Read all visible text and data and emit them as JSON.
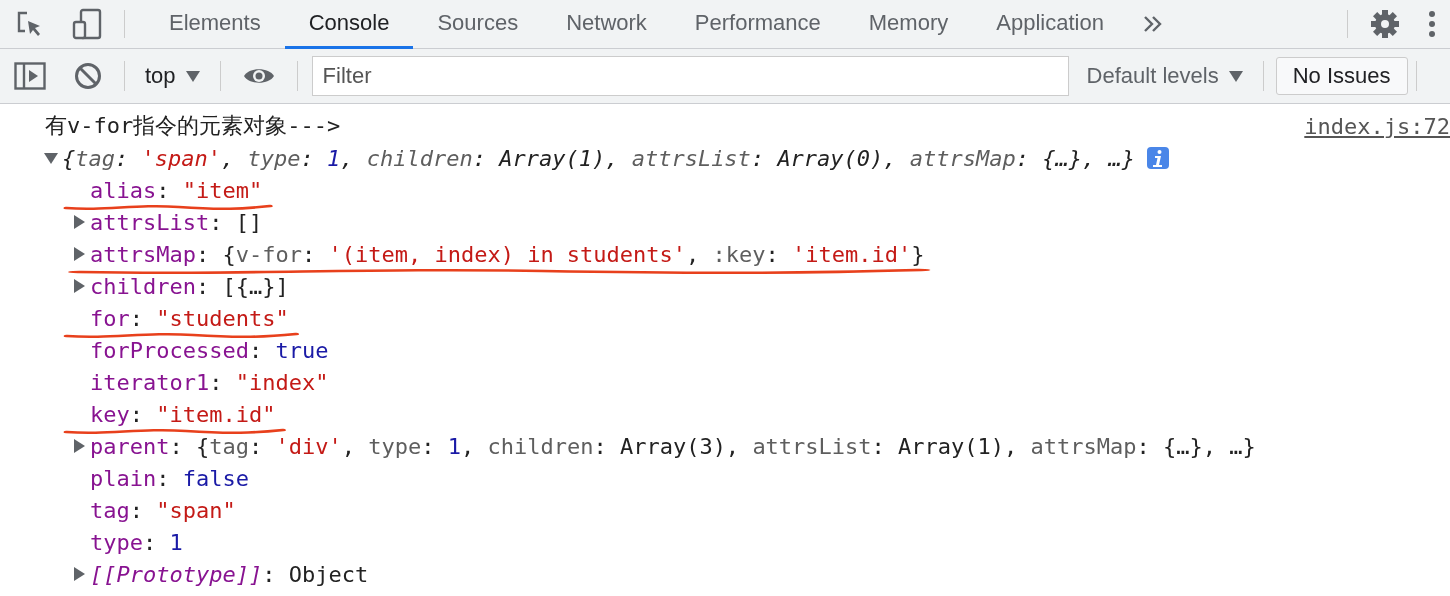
{
  "tabs": [
    {
      "label": "Elements",
      "selected": false
    },
    {
      "label": "Console",
      "selected": true
    },
    {
      "label": "Sources",
      "selected": false
    },
    {
      "label": "Network",
      "selected": false
    },
    {
      "label": "Performance",
      "selected": false
    },
    {
      "label": "Memory",
      "selected": false
    },
    {
      "label": "Application",
      "selected": false
    }
  ],
  "toolbar": {
    "context": "top",
    "filter": {
      "placeholder": "Filter"
    },
    "levels": "Default levels",
    "issues": "No Issues"
  },
  "console": {
    "message": "有v-for指令的元素对象--->",
    "source": "index.js:72",
    "lines": [
      {
        "kind": "group",
        "expanded": true,
        "italic": true,
        "info": true,
        "tokens": [
          {
            "kind": "punct",
            "text": "{"
          },
          {
            "kind": "dim",
            "text": "tag"
          },
          {
            "kind": "punct",
            "text": ": "
          },
          {
            "kind": "str",
            "text": "'span'"
          },
          {
            "kind": "punct",
            "text": ", "
          },
          {
            "kind": "dim",
            "text": "type"
          },
          {
            "kind": "punct",
            "text": ": "
          },
          {
            "kind": "num",
            "text": "1"
          },
          {
            "kind": "punct",
            "text": ", "
          },
          {
            "kind": "dim",
            "text": "children"
          },
          {
            "kind": "punct",
            "text": ": "
          },
          {
            "kind": "punct",
            "text": "Array(1)"
          },
          {
            "kind": "punct",
            "text": ", "
          },
          {
            "kind": "dim",
            "text": "attrsList"
          },
          {
            "kind": "punct",
            "text": ": "
          },
          {
            "kind": "punct",
            "text": "Array(0)"
          },
          {
            "kind": "punct",
            "text": ", "
          },
          {
            "kind": "dim",
            "text": "attrsMap"
          },
          {
            "kind": "punct",
            "text": ": "
          },
          {
            "kind": "punct",
            "text": "{…}, …}"
          }
        ],
        "children": [
          {
            "kind": "leaf",
            "marked": true,
            "tokens": [
              {
                "kind": "key",
                "text": "alias"
              },
              {
                "kind": "punct",
                "text": ": "
              },
              {
                "kind": "str",
                "text": "\"item\""
              }
            ]
          },
          {
            "kind": "group",
            "expanded": false,
            "tokens": [
              {
                "kind": "key",
                "text": "attrsList"
              },
              {
                "kind": "punct",
                "text": ": []"
              }
            ]
          },
          {
            "kind": "group",
            "expanded": false,
            "marked": true,
            "tokens": [
              {
                "kind": "key",
                "text": "attrsMap"
              },
              {
                "kind": "punct",
                "text": ": {"
              },
              {
                "kind": "dim",
                "text": "v-for"
              },
              {
                "kind": "punct",
                "text": ": "
              },
              {
                "kind": "str",
                "text": "'(item, index) in students'"
              },
              {
                "kind": "punct",
                "text": ", "
              },
              {
                "kind": "dim",
                "text": ":key"
              },
              {
                "kind": "punct",
                "text": ": "
              },
              {
                "kind": "str",
                "text": "'item.id'"
              },
              {
                "kind": "punct",
                "text": "}"
              }
            ]
          },
          {
            "kind": "group",
            "expanded": false,
            "tokens": [
              {
                "kind": "key",
                "text": "children"
              },
              {
                "kind": "punct",
                "text": ": [{…}]"
              }
            ]
          },
          {
            "kind": "leaf",
            "marked": true,
            "tokens": [
              {
                "kind": "key",
                "text": "for"
              },
              {
                "kind": "punct",
                "text": ": "
              },
              {
                "kind": "str",
                "text": "\"students\""
              }
            ]
          },
          {
            "kind": "leaf",
            "tokens": [
              {
                "kind": "key",
                "text": "forProcessed"
              },
              {
                "kind": "punct",
                "text": ": "
              },
              {
                "kind": "num",
                "text": "true"
              }
            ]
          },
          {
            "kind": "leaf",
            "tokens": [
              {
                "kind": "key",
                "text": "iterator1"
              },
              {
                "kind": "punct",
                "text": ": "
              },
              {
                "kind": "str",
                "text": "\"index\""
              }
            ]
          },
          {
            "kind": "leaf",
            "marked": true,
            "tokens": [
              {
                "kind": "key",
                "text": "key"
              },
              {
                "kind": "punct",
                "text": ": "
              },
              {
                "kind": "str",
                "text": "\"item.id\""
              }
            ]
          },
          {
            "kind": "group",
            "expanded": false,
            "tokens": [
              {
                "kind": "key",
                "text": "parent"
              },
              {
                "kind": "punct",
                "text": ": {"
              },
              {
                "kind": "dim",
                "text": "tag"
              },
              {
                "kind": "punct",
                "text": ": "
              },
              {
                "kind": "str",
                "text": "'div'"
              },
              {
                "kind": "punct",
                "text": ", "
              },
              {
                "kind": "dim",
                "text": "type"
              },
              {
                "kind": "punct",
                "text": ": "
              },
              {
                "kind": "num",
                "text": "1"
              },
              {
                "kind": "punct",
                "text": ", "
              },
              {
                "kind": "dim",
                "text": "children"
              },
              {
                "kind": "punct",
                "text": ": Array(3), "
              },
              {
                "kind": "dim",
                "text": "attrsList"
              },
              {
                "kind": "punct",
                "text": ": Array(1), "
              },
              {
                "kind": "dim",
                "text": "attrsMap"
              },
              {
                "kind": "punct",
                "text": ": {…}, …}"
              }
            ]
          },
          {
            "kind": "leaf",
            "tokens": [
              {
                "kind": "key",
                "text": "plain"
              },
              {
                "kind": "punct",
                "text": ": "
              },
              {
                "kind": "num",
                "text": "false"
              }
            ]
          },
          {
            "kind": "leaf",
            "tokens": [
              {
                "kind": "key",
                "text": "tag"
              },
              {
                "kind": "punct",
                "text": ": "
              },
              {
                "kind": "str",
                "text": "\"span\""
              }
            ]
          },
          {
            "kind": "leaf",
            "tokens": [
              {
                "kind": "key",
                "text": "type"
              },
              {
                "kind": "punct",
                "text": ": "
              },
              {
                "kind": "num",
                "text": "1"
              }
            ]
          },
          {
            "kind": "group",
            "expanded": false,
            "tokens": [
              {
                "kind": "key_italic",
                "text": "[[Prototype]]"
              },
              {
                "kind": "punct",
                "text": ": Object"
              }
            ]
          }
        ]
      }
    ]
  }
}
